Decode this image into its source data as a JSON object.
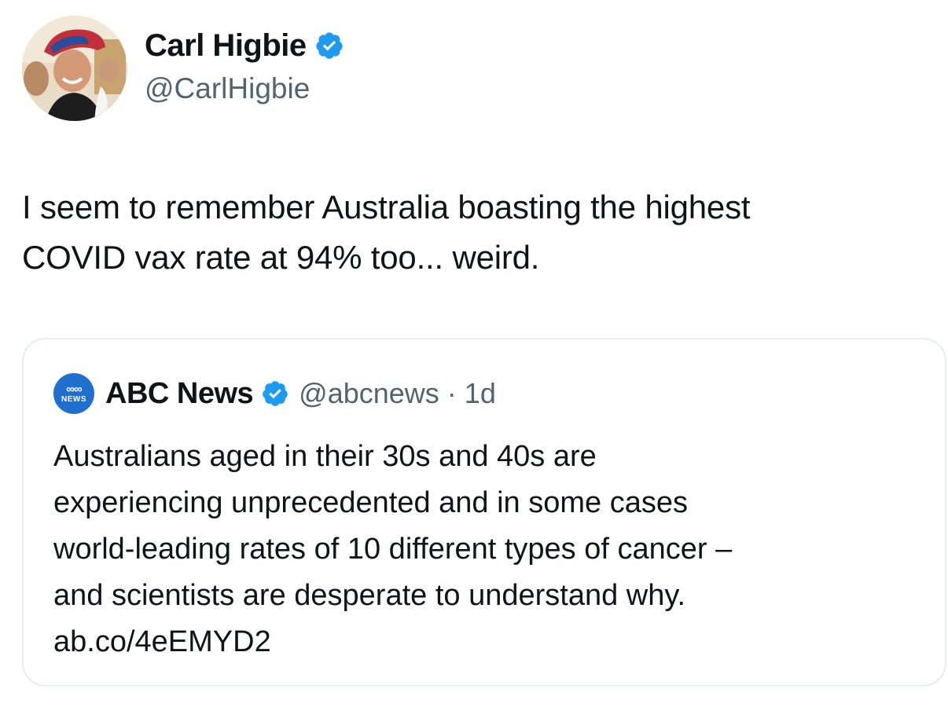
{
  "author": {
    "display_name": "Carl Higbie",
    "handle": "@CarlHigbie"
  },
  "tweet": {
    "text_lines": [
      "I seem to remember Australia boasting the highest",
      "COVID vax rate at 94% too... weird."
    ]
  },
  "quoted": {
    "logo_text": "NEWS",
    "display_name": "ABC News",
    "handle": "@abcnews",
    "separator": "·",
    "time": "1d",
    "text_lines": [
      "Australians aged in their 30s and 40s are",
      "experiencing unprecedented and in some cases",
      "world-leading rates of 10 different types of cancer –",
      "and scientists are desperate to understand why.",
      "ab.co/4eEMYD2"
    ]
  },
  "colors": {
    "verified_badge": "#1d9bf0",
    "secondary_text": "#536471",
    "abc_logo": "#1f6fd1",
    "quote_border": "#e6ecf0"
  },
  "icons": [
    "verified-badge-icon",
    "abc-news-logo"
  ]
}
